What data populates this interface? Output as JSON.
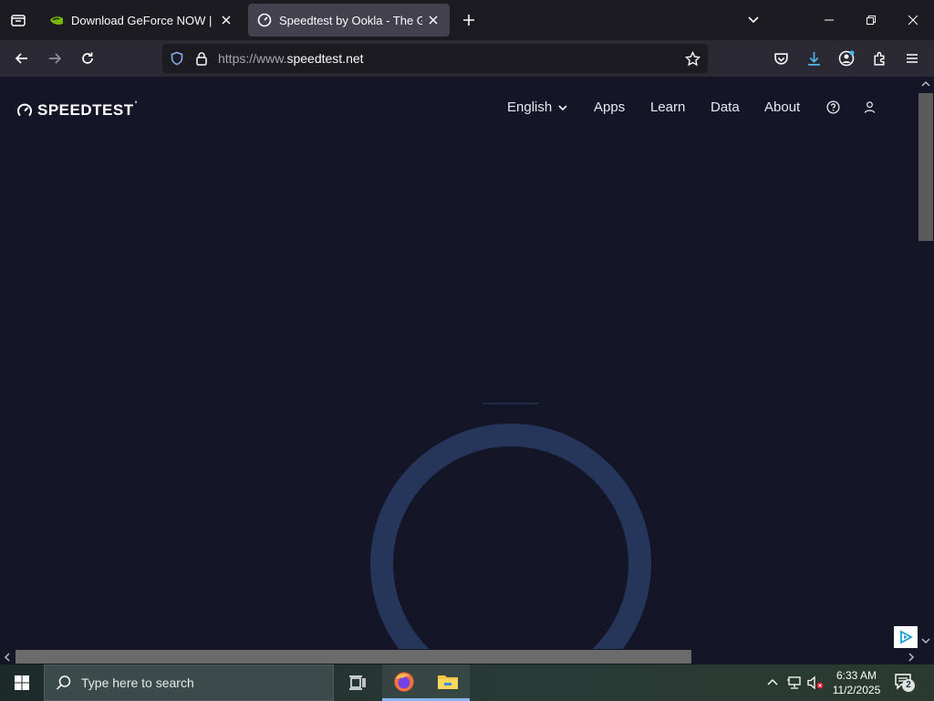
{
  "browser": {
    "tabs": [
      {
        "title": "Download GeForce NOW | NVIDIA",
        "active": false,
        "favicon": "nvidia-icon"
      },
      {
        "title": "Speedtest by Ookla - The Global Broadband Speed Test",
        "active": true,
        "favicon": "speedtest-icon"
      }
    ],
    "url_protocol": "https://www.",
    "url_domain": "speedtest.net"
  },
  "site": {
    "logo_text": "SPEEDTEST",
    "nav": {
      "language": "English",
      "apps": "Apps",
      "learn": "Learn",
      "data": "Data",
      "about": "About"
    }
  },
  "taskbar": {
    "search_placeholder": "Type here to search",
    "time": "6:33 AM",
    "date": "11/2/2025",
    "notification_count": "2"
  },
  "colors": {
    "page_bg": "#141526",
    "gauge_ring": "#26355a",
    "active_tab": "#42414d"
  }
}
